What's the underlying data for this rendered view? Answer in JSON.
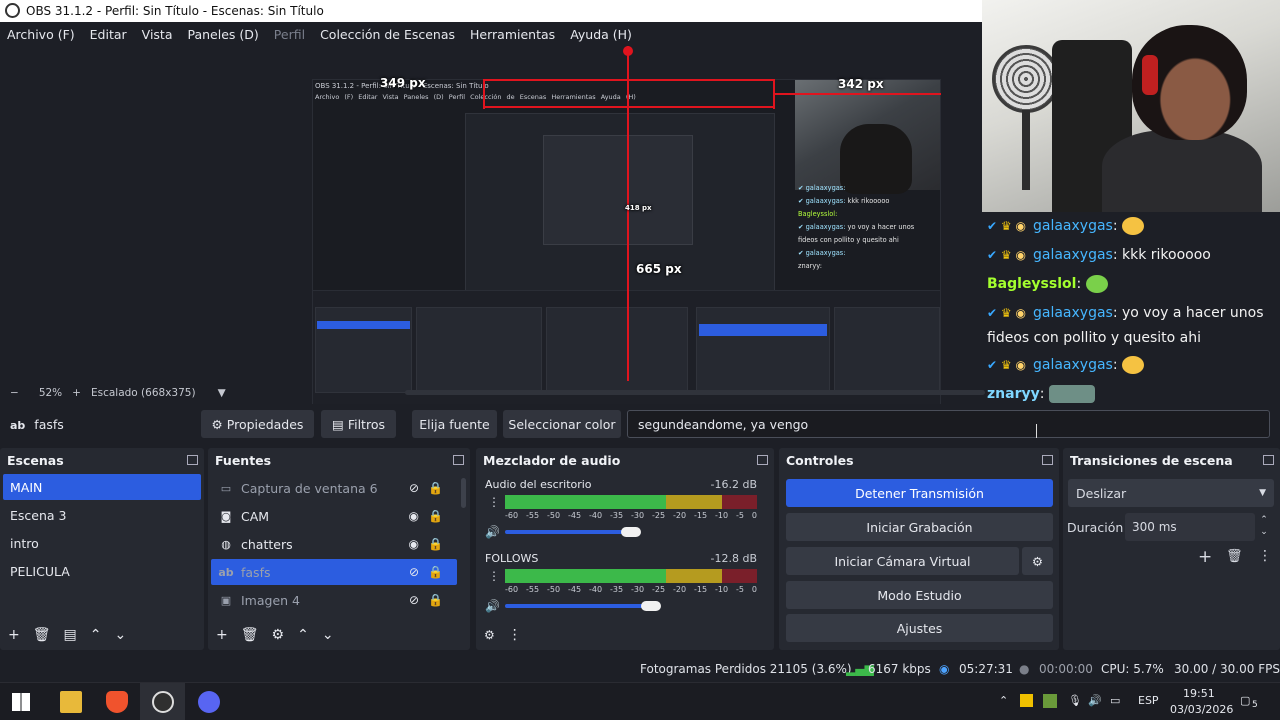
{
  "window": {
    "title": "OBS 31.1.2 - Perfil: Sin Título - Escenas: Sin Título"
  },
  "menu": [
    "Archivo (F)",
    "Editar",
    "Vista",
    "Paneles (D)",
    "Perfil",
    "Colección de Escenas",
    "Herramientas",
    "Ayuda (H)"
  ],
  "preview": {
    "capture_title": "OBS 31.1.2 - Perfil: Sin Título - Escenas: Sin Título",
    "capture_menu": "Archivo (F)  Editar  Vista  Paneles (D)  Perfil  Colección de Escenas  Herramientas  Ayuda (H)",
    "measure_top": "349 px",
    "measure_right": "342 px",
    "measure_bottom": "665 px",
    "measure_inner": "418 px",
    "zoom": "52%",
    "scaling": "Escalado (668x375)"
  },
  "chat": {
    "messages": [
      {
        "user": "galaaxygas",
        "text": ""
      },
      {
        "user": "galaaxygas",
        "text": ": kkk rikooooo"
      },
      {
        "user": "Bagleysslol",
        "text": ":"
      },
      {
        "user": "galaaxygas",
        "text": ": yo voy a hacer unos fideos con pollito y quesito ahi"
      },
      {
        "user": "galaaxygas",
        "text": ":"
      },
      {
        "user": "znaryy",
        "text": ":"
      }
    ]
  },
  "source_toolbar": {
    "source_name": "fasfs",
    "properties": "Propiedades",
    "filters": "Filtros",
    "choose_font": "Elija fuente",
    "select_color": "Seleccionar color",
    "text_value": "segundeandome, ya vengo"
  },
  "scenes": {
    "title": "Escenas",
    "items": [
      "MAIN",
      "Escena 3",
      "intro",
      "PELICULA"
    ]
  },
  "sources": {
    "title": "Fuentes",
    "items": [
      "Captura de ventana 6",
      "CAM",
      "chatters",
      "fasfs",
      "Imagen 4"
    ]
  },
  "mixer": {
    "title": "Mezclador de audio",
    "tracks": [
      {
        "name": "Audio del escritorio",
        "db": "-16.2 dB",
        "level": 0.5
      },
      {
        "name": "FOLLOWS",
        "db": "-12.8 dB",
        "level": 0.58
      }
    ],
    "scale": [
      "-60",
      "-55",
      "-50",
      "-45",
      "-40",
      "-35",
      "-30",
      "-25",
      "-20",
      "-15",
      "-10",
      "-5",
      "0"
    ]
  },
  "controls": {
    "title": "Controles",
    "stop_stream": "Detener Transmisión",
    "start_record": "Iniciar Grabación",
    "virtual_cam": "Iniciar Cámara Virtual",
    "studio_mode": "Modo Estudio",
    "settings": "Ajustes"
  },
  "transitions": {
    "title": "Transiciones de escena",
    "selected": "Deslizar",
    "duration_label": "Duración",
    "duration_value": "300 ms"
  },
  "status": {
    "dropped": "Fotogramas Perdidos 21105 (3.6%)",
    "bitrate": "6167 kbps",
    "stream_time": "05:27:31",
    "record_time": "00:00:00",
    "cpu": "CPU: 5.7%",
    "fps": "30.00 / 30.00 FPS"
  },
  "taskbar": {
    "lang": "ESP",
    "time": "19:51",
    "date": "03/03/2026",
    "notif_count": "5"
  },
  "colors": {
    "accent": "#2c5de0",
    "background": "#1d1f26",
    "dock": "#262931",
    "guide": "#e0141e"
  }
}
